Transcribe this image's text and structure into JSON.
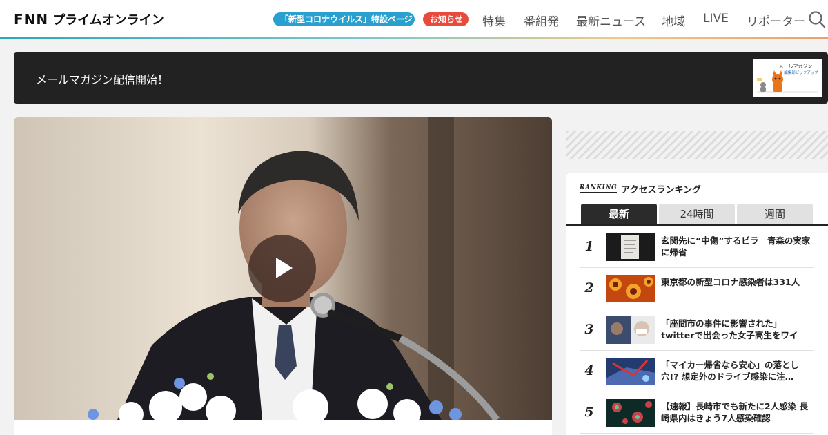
{
  "header": {
    "logo_mark": "FNN",
    "logo_text": "プライムオンライン",
    "pill_corona": "「新型コロナウイルス」特設ページ",
    "pill_notice": "お知らせ",
    "nav": [
      "特集",
      "番組発",
      "最新ニュース",
      "地域",
      "LIVE",
      "リポーター"
    ],
    "search_icon": "search-icon",
    "accent_colors": [
      "#2aa0cf",
      "#e84a3c"
    ]
  },
  "banner": {
    "text": "メールマガジン配信開始！",
    "thumb_caption_1": "メールマガジン",
    "thumb_caption_2": "編集部ピックアップ"
  },
  "video": {
    "play_icon": "play-icon"
  },
  "ranking": {
    "badge": "RANKING",
    "title": "アクセスランキング",
    "tabs": [
      "最新",
      "24時間",
      "週間"
    ],
    "active_tab": "最新",
    "items": [
      {
        "rank": "1",
        "text": "玄関先に“中傷”するビラ　青森の実家に帰省"
      },
      {
        "rank": "2",
        "text": "東京都の新型コロナ感染者は331人"
      },
      {
        "rank": "3",
        "text": "「座間市の事件に影響された」twitterで出会った女子高生をワイヤ…"
      },
      {
        "rank": "4",
        "text": "「マイカー帰省なら安心」の落とし穴!? 想定外のドライブ感染に注…"
      },
      {
        "rank": "5",
        "text": "【速報】長崎市でも新たに2人感染 長崎県内はきょう7人感染確認"
      }
    ]
  }
}
